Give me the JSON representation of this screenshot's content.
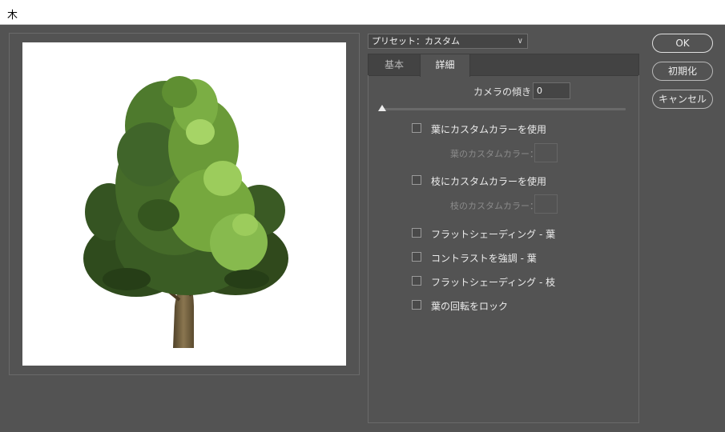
{
  "window": {
    "title": "木"
  },
  "preset": {
    "label": "プリセット：カスタム"
  },
  "tabs": [
    {
      "label": "基本",
      "active": false
    },
    {
      "label": "詳細",
      "active": true
    }
  ],
  "camera_tilt": {
    "label": "カメラの傾き：",
    "value": "0",
    "slider_fraction": 0
  },
  "options": {
    "leaf_custom_color": {
      "label": "葉にカスタムカラーを使用",
      "checked": false
    },
    "leaf_color_swatch_label": "葉のカスタムカラー：",
    "branch_custom_color": {
      "label": "枝にカスタムカラーを使用",
      "checked": false
    },
    "branch_color_swatch_label": "枝のカスタムカラー：",
    "flat_shading_leaf": {
      "label": "フラットシェーディング - 葉",
      "checked": false
    },
    "contrast_leaf": {
      "label": "コントラストを強調 - 葉",
      "checked": false
    },
    "flat_shading_branch": {
      "label": "フラットシェーディング - 枝",
      "checked": false
    },
    "lock_leaf_rotation": {
      "label": "葉の回転をロック",
      "checked": false
    }
  },
  "buttons": {
    "ok": "OK",
    "reset": "初期化",
    "cancel": "キャンセル"
  },
  "colors": {
    "dialog_bg": "#535353",
    "foliage_dark": "#2e4a1c",
    "foliage_mid": "#4f7a2c",
    "foliage_light": "#8fc054",
    "trunk": "#6e5a3a"
  }
}
